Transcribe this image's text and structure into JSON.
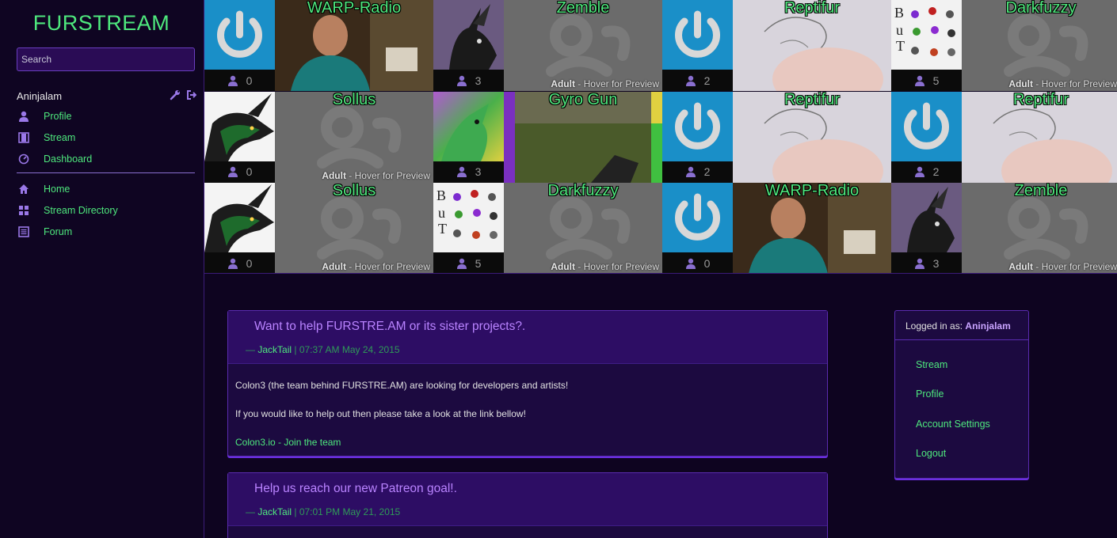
{
  "app": {
    "logo": "FURSTREAM"
  },
  "search": {
    "placeholder": "Search"
  },
  "user": {
    "name": "Aninjalam"
  },
  "nav": [
    {
      "label": "Profile",
      "icon": "user-icon"
    },
    {
      "label": "Stream",
      "icon": "film-icon"
    },
    {
      "label": "Dashboard",
      "icon": "dashboard-icon"
    },
    {
      "label": "Home",
      "icon": "home-icon"
    },
    {
      "label": "Stream Directory",
      "icon": "grid-icon"
    },
    {
      "label": "Forum",
      "icon": "list-icon"
    }
  ],
  "streams": [
    {
      "title": "WARP-Radio",
      "viewers": "0",
      "adult": false,
      "thumb": "power",
      "preview": "person"
    },
    {
      "title": "Zemble",
      "viewers": "3",
      "adult": true,
      "thumb": "dragon-dark",
      "preview": "none"
    },
    {
      "title": "Reptifur",
      "viewers": "2",
      "adult": false,
      "thumb": "power",
      "preview": "sketch"
    },
    {
      "title": "Darkfuzzy",
      "viewers": "5",
      "adult": true,
      "thumb": "doodles",
      "preview": "none"
    },
    {
      "title": "Sollus",
      "viewers": "0",
      "adult": true,
      "thumb": "dragon-green",
      "preview": "none"
    },
    {
      "title": "Gyro Gun",
      "viewers": "3",
      "adult": false,
      "thumb": "green-char",
      "preview": "game"
    },
    {
      "title": "Reptifur",
      "viewers": "2",
      "adult": false,
      "thumb": "power",
      "preview": "sketch"
    },
    {
      "title": "Reptifur",
      "viewers": "2",
      "adult": false,
      "thumb": "power",
      "preview": "sketch"
    },
    {
      "title": "Sollus",
      "viewers": "0",
      "adult": true,
      "thumb": "dragon-green",
      "preview": "none"
    },
    {
      "title": "Darkfuzzy",
      "viewers": "5",
      "adult": true,
      "thumb": "doodles",
      "preview": "none"
    },
    {
      "title": "WARP-Radio",
      "viewers": "0",
      "adult": false,
      "thumb": "power",
      "preview": "person"
    },
    {
      "title": "Zemble",
      "viewers": "3",
      "adult": true,
      "thumb": "dragon-dark",
      "preview": "none"
    }
  ],
  "adult_label": {
    "bold": "Adult",
    "rest": " - Hover for Preview"
  },
  "posts": [
    {
      "title": "Want to help FURSTRE.AM or its sister projects?.",
      "dash": "— ",
      "author": "JackTail",
      "date": " | 07:37 AM May 24, 2015",
      "body": [
        "Colon3 (the team behind FURSTRE.AM) are looking for developers and artists!",
        "If you would like to help out then please take a look at the link bellow!"
      ],
      "link": "Colon3.io - Join the team"
    },
    {
      "title": "Help us reach our new Patreon goal!.",
      "dash": "— ",
      "author": "JackTail",
      "date": " | 07:01 PM May 21, 2015"
    }
  ],
  "account": {
    "logged_prefix": "Logged in as: ",
    "username": "Aninjalam",
    "links": [
      "Stream",
      "Profile",
      "Account Settings",
      "Logout"
    ]
  },
  "colors": {
    "accent_green": "#4ee87d",
    "accent_purple": "#b983ff",
    "power_blue": "#1a8fc8",
    "background": "#0e0420"
  }
}
